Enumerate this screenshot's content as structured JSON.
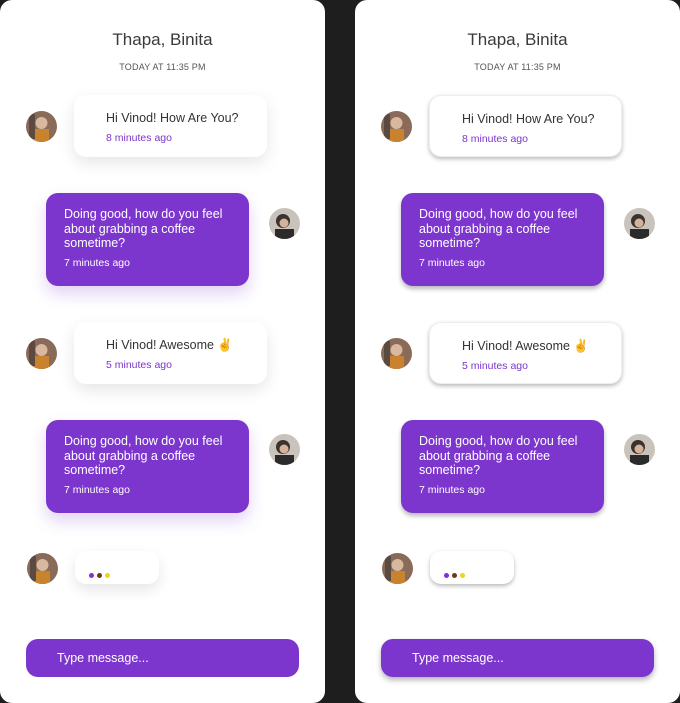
{
  "contact_name": "Thapa, Binita",
  "timestamp": "TODAY AT 11:35 PM",
  "messages": [
    {
      "text": "Hi Vinod! How Are You?",
      "time": "8 minutes ago"
    },
    {
      "text": "Doing good, how do you feel about grabbing a coffee sometime?",
      "time": "7 minutes ago"
    },
    {
      "text": "Hi Vinod! Awesome ✌️",
      "time": "5 minutes ago"
    },
    {
      "text": "Doing good, how do you feel about grabbing a coffee sometime?",
      "time": "7 minutes ago"
    }
  ],
  "typing_dots": [
    "#7c35cd",
    "#6b3a1f",
    "#f2d21b"
  ],
  "composer_placeholder": "Type message...",
  "colors": {
    "accent": "#7c35cd",
    "background": "#1e1e1e",
    "panel": "#ffffff"
  }
}
